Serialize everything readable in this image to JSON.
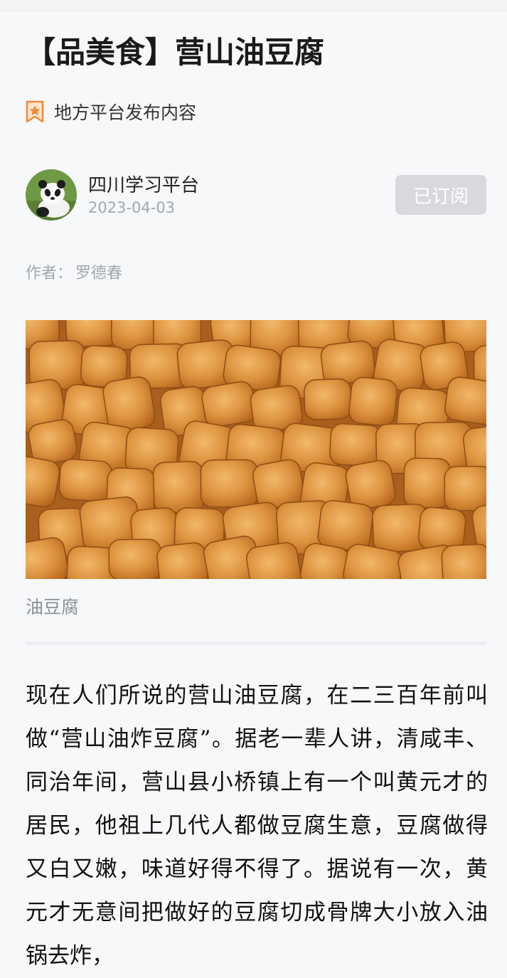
{
  "article": {
    "title": "【品美食】营山油豆腐",
    "source_label": "地方平台发布内容",
    "source_icon": "bookmark-star-icon",
    "author_account": "四川学习平台",
    "publish_date": "2023-04-03",
    "subscribe_label": "已订阅",
    "byline_label": "作者：",
    "byline_name": "罗德春",
    "image_caption": "油豆腐",
    "body": "现在人们所说的营山油豆腐，在二三百年前叫做“营山油炸豆腐”。据老一辈人讲，清咸丰、同治年间，营山县小桥镇上有一个叫黄元才的居民，他祖上几代人都做豆腐生意，豆腐做得又白又嫩，味道好得不得了。据说有一次，黄元才无意间把做好的豆腐切成骨牌大小放入油锅去炸，"
  },
  "colors": {
    "background": "#f7f8fa",
    "icon_accent": "#ef8a3a",
    "subscribe_bg": "#d7d9de",
    "meta_gray": "#a3a6ad"
  }
}
